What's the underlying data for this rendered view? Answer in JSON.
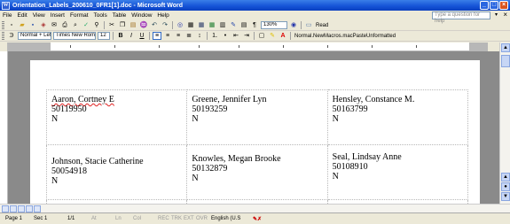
{
  "window": {
    "title": "Orientation_Labels_200610_0FR1[1].doc - Microsoft Word",
    "app_icon_letter": "W",
    "minimize": "_",
    "maximize": "□",
    "close": "×"
  },
  "menu": {
    "items": [
      "File",
      "Edit",
      "View",
      "Insert",
      "Format",
      "Tools",
      "Table",
      "Window",
      "Help"
    ],
    "help_placeholder": "Type a question for help",
    "help_arrow": "▾",
    "doc_close": "×"
  },
  "standard_toolbar": {
    "zoom": "130%",
    "read_label": "Read",
    "icons": [
      "new-icon",
      "open-icon",
      "save-icon",
      "permission-icon",
      "email-icon",
      "print-icon",
      "print-preview-icon",
      "spelling-icon",
      "research-icon",
      "cut-icon",
      "copy-icon",
      "paste-icon",
      "format-painter-icon",
      "undo-icon",
      "redo-icon",
      "hyperlink-icon",
      "tables-borders-icon",
      "insert-table-icon",
      "excel-icon",
      "columns-icon",
      "drawing-icon",
      "document-map-icon",
      "show-hide-icon",
      "help-icon"
    ]
  },
  "formatting_toolbar": {
    "style": "Normal + Left:",
    "font": "Times New Roman",
    "size": "12",
    "bold": "B",
    "italic": "I",
    "underline": "U",
    "font_color_letter": "A",
    "macro_label": "Normal.NewMacros.macPasteUnformatted"
  },
  "labels": [
    [
      {
        "name": "Aaron, Cortney E",
        "id": "50119950",
        "flag": "N"
      },
      {
        "name": "Greene, Jennifer Lyn",
        "id": "50193259",
        "flag": "N"
      },
      {
        "name": "Hensley, Constance M.",
        "id": "50163799",
        "flag": "N"
      }
    ],
    [
      {
        "name": "Johnson, Stacie Catherine",
        "id": "50054918",
        "flag": "N"
      },
      {
        "name": "Knowles, Megan Brooke",
        "id": "50132879",
        "flag": "N"
      },
      {
        "name": "Seal, Lindsay Anne",
        "id": "50108910",
        "flag": "N"
      }
    ]
  ],
  "status": {
    "page": "Page 1",
    "sec": "Sec 1",
    "pages": "1/1",
    "at": "At",
    "ln": "Ln",
    "col": "Col",
    "rec": "REC",
    "trk": "TRK",
    "ext": "EXT",
    "ovr": "OVR",
    "language": "English (U.S",
    "spell_icon": "spell-check-icon"
  }
}
